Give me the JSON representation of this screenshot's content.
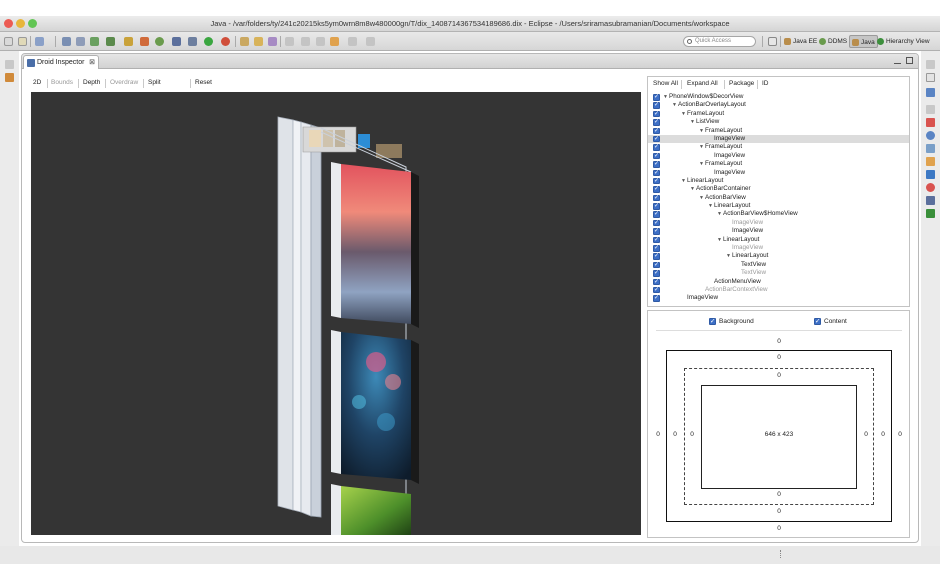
{
  "window": {
    "title": "Java - /var/folders/ty/241c20215ks5ym0wrn8m8w480000gn/T/dix_1408714367534189686.dix - Eclipse - /Users/sriramasubramanian/Documents/workspace"
  },
  "toolbar": {
    "quick_access_placeholder": "Quick Access",
    "perspectives": [
      {
        "label": "Java EE",
        "active": false
      },
      {
        "label": "DDMS",
        "active": false
      },
      {
        "label": "Java",
        "active": true
      },
      {
        "label": "Hierarchy View",
        "active": false
      }
    ]
  },
  "editor": {
    "tab_label": "Droid Inspector",
    "tab_close": "⊠",
    "modes": [
      {
        "label": "2D",
        "enabled": true
      },
      {
        "label": "Bounds",
        "enabled": false
      },
      {
        "label": "Depth",
        "enabled": true
      },
      {
        "label": "Overdraw",
        "enabled": false
      },
      {
        "label": "Split Content",
        "enabled": true
      },
      {
        "label": "Reset",
        "enabled": true
      }
    ]
  },
  "tree": {
    "toolbar": [
      "Show All",
      "Expand All",
      "Package",
      "ID"
    ],
    "nodes": [
      {
        "label": "PhoneWindow$DecorView",
        "depth": 0,
        "expandable": true,
        "dim": false,
        "selected": false
      },
      {
        "label": "ActionBarOverlayLayout",
        "depth": 1,
        "expandable": true,
        "dim": false,
        "selected": false
      },
      {
        "label": "FrameLayout",
        "depth": 2,
        "expandable": true,
        "dim": false,
        "selected": false
      },
      {
        "label": "ListView",
        "depth": 3,
        "expandable": true,
        "dim": false,
        "selected": false
      },
      {
        "label": "FrameLayout",
        "depth": 4,
        "expandable": true,
        "dim": false,
        "selected": false
      },
      {
        "label": "ImageView",
        "depth": 5,
        "expandable": false,
        "dim": false,
        "selected": true
      },
      {
        "label": "FrameLayout",
        "depth": 4,
        "expandable": true,
        "dim": false,
        "selected": false
      },
      {
        "label": "ImageView",
        "depth": 5,
        "expandable": false,
        "dim": false,
        "selected": false
      },
      {
        "label": "FrameLayout",
        "depth": 4,
        "expandable": true,
        "dim": false,
        "selected": false
      },
      {
        "label": "ImageView",
        "depth": 5,
        "expandable": false,
        "dim": false,
        "selected": false
      },
      {
        "label": "LinearLayout",
        "depth": 2,
        "expandable": true,
        "dim": false,
        "selected": false
      },
      {
        "label": "ActionBarContainer",
        "depth": 3,
        "expandable": true,
        "dim": false,
        "selected": false
      },
      {
        "label": "ActionBarView",
        "depth": 4,
        "expandable": true,
        "dim": false,
        "selected": false
      },
      {
        "label": "LinearLayout",
        "depth": 5,
        "expandable": true,
        "dim": false,
        "selected": false
      },
      {
        "label": "ActionBarView$HomeView",
        "depth": 6,
        "expandable": true,
        "dim": false,
        "selected": false
      },
      {
        "label": "ImageView",
        "depth": 7,
        "expandable": false,
        "dim": true,
        "selected": false
      },
      {
        "label": "ImageView",
        "depth": 7,
        "expandable": false,
        "dim": false,
        "selected": false
      },
      {
        "label": "LinearLayout",
        "depth": 6,
        "expandable": true,
        "dim": false,
        "selected": false
      },
      {
        "label": "ImageView",
        "depth": 7,
        "expandable": false,
        "dim": true,
        "selected": false
      },
      {
        "label": "LinearLayout",
        "depth": 7,
        "expandable": true,
        "dim": false,
        "selected": false
      },
      {
        "label": "TextView",
        "depth": 8,
        "expandable": false,
        "dim": false,
        "selected": false
      },
      {
        "label": "TextView",
        "depth": 8,
        "expandable": false,
        "dim": true,
        "selected": false
      },
      {
        "label": "ActionMenuView",
        "depth": 5,
        "expandable": false,
        "dim": false,
        "selected": false
      },
      {
        "label": "ActionBarContextView",
        "depth": 4,
        "expandable": false,
        "dim": true,
        "selected": false
      },
      {
        "label": "ImageView",
        "depth": 2,
        "expandable": false,
        "dim": false,
        "selected": false
      }
    ]
  },
  "box_model": {
    "background_label": "Background",
    "content_label": "Content",
    "margin": {
      "top": "0",
      "right": "0",
      "bottom": "0",
      "left": "0"
    },
    "border": {
      "top": "0",
      "right": "0",
      "bottom": "0",
      "left": "0"
    },
    "padding": {
      "top": "0",
      "right": "0",
      "bottom": "0",
      "left": "0"
    },
    "dimensions": "646 x 423"
  },
  "colors": {
    "canvas_bg": "#343434",
    "checkbox": "#3d6fc6",
    "close_light": "#ec5b53",
    "minimize_light": "#e8b63b",
    "zoom_light": "#62c554"
  }
}
